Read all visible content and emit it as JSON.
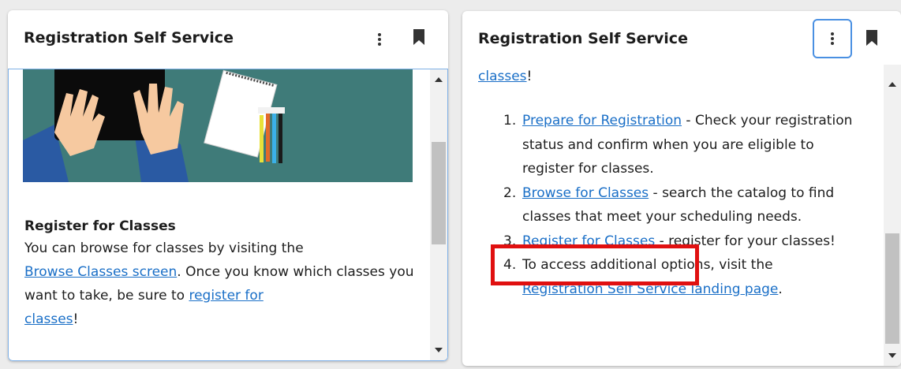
{
  "left_card": {
    "title": "Registration Self Service",
    "icons": {
      "menu": "kebab-menu-icon",
      "bookmark": "bookmark-icon"
    },
    "section_heading": "Register for Classes",
    "text_1": "You can browse for classes by visiting the",
    "browse_link": "Browse Classes screen",
    "text_2": ". Once you know which classes you want to take, be sure to",
    "register_link_a": "register for",
    "register_link_b": "classes",
    "text_end": "!"
  },
  "right_card": {
    "title": "Registration Self Service",
    "icons": {
      "menu": "kebab-menu-icon",
      "bookmark": "bookmark-icon"
    },
    "top_link": "classes",
    "top_text": "!",
    "steps": [
      {
        "num": "1.",
        "link": "Prepare for Registration",
        "text": " - Check your registration status and confirm when you are eligible to register for classes."
      },
      {
        "num": "2.",
        "link": "Browse for Classes",
        "text": " - search the catalog to find classes that meet your scheduling needs."
      },
      {
        "num": "3.",
        "link": "Register for Classes",
        "text": " - register for your classes!"
      },
      {
        "num": "4.",
        "text_prefix": "To access additional options, visit the",
        "link": "Registration Self Service landing page",
        "text": "."
      }
    ]
  },
  "colors": {
    "accent_link": "#1a6fc7",
    "highlight": "#e01010",
    "focus": "#4a90e2",
    "illustration_bg": "#3f7b79"
  }
}
